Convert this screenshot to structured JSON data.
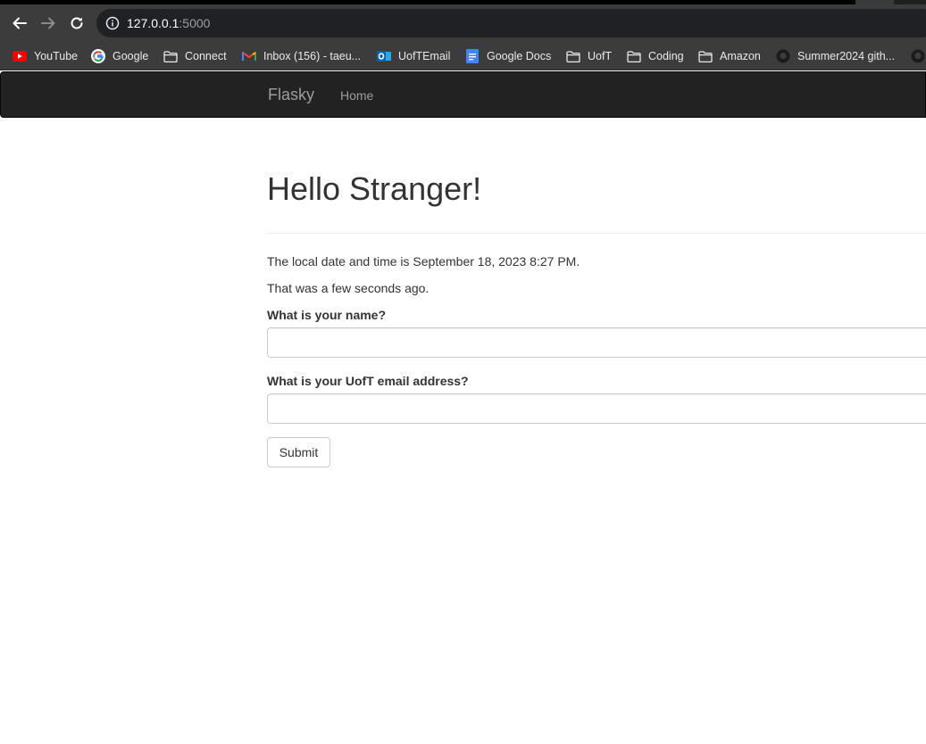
{
  "browser": {
    "url_host": "127.0.0.1",
    "url_port": ":5000",
    "bookmarks": [
      {
        "label": "YouTube",
        "icon": "youtube-icon"
      },
      {
        "label": "Google",
        "icon": "google-icon"
      },
      {
        "label": "Connect",
        "icon": "folder-icon"
      },
      {
        "label": "Inbox (156) - taeu...",
        "icon": "gmail-icon"
      },
      {
        "label": "UofTEmail",
        "icon": "outlook-icon"
      },
      {
        "label": "Google Docs",
        "icon": "google-docs-icon"
      },
      {
        "label": "UofT",
        "icon": "folder-icon"
      },
      {
        "label": "Coding",
        "icon": "folder-icon"
      },
      {
        "label": "Amazon",
        "icon": "folder-icon"
      },
      {
        "label": "Summer2024 gith...",
        "icon": "github-icon"
      }
    ]
  },
  "navbar": {
    "brand": "Flasky",
    "home": "Home"
  },
  "main": {
    "title": "Hello Stranger!",
    "datetime_text": "The local date and time is September 18, 2023 8:27 PM.",
    "relative_text": "That was a few seconds ago.",
    "name_label": "What is your name?",
    "name_value": "",
    "email_label": "What is your UofT email address?",
    "email_value": "",
    "submit_label": "Submit"
  },
  "colors": {
    "navbar_bg": "#222222",
    "navbar_text": "#9d9d9d",
    "text": "#333333",
    "chrome_bg": "#3c3c3c"
  }
}
